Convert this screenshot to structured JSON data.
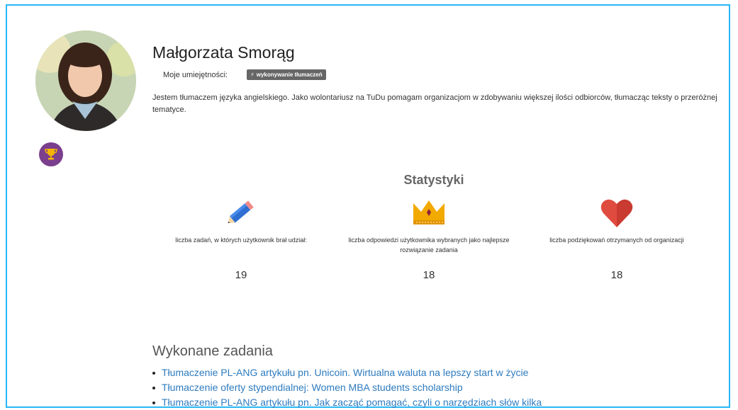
{
  "profile": {
    "name": "Małgorzata Smorąg",
    "skills_label": "Moje umiejętności:",
    "skills": [
      "wykonywanie tłumaczeń"
    ],
    "bio": "Jestem tłumaczem języka angielskiego. Jako wolontariusz na TuDu pomagam organizacjom w zdobywaniu większej ilości odbiorców, tłumacząc teksty o przeróżnej tematyce."
  },
  "stats": {
    "title": "Statystyki",
    "items": [
      {
        "icon": "pencil-icon",
        "label": "liczba zadań, w których użytkownik brał udział:",
        "value": "19"
      },
      {
        "icon": "crown-icon",
        "label": "liczba odpowiedzi użytkownika wybranych jako najlepsze rozwiązanie zadania",
        "value": "18"
      },
      {
        "icon": "heart-icon",
        "label": "liczba podziękowań otrzymanych od organizacji",
        "value": "18"
      }
    ]
  },
  "tasks": {
    "title": "Wykonane zadania",
    "items": [
      "Tłumaczenie PL-ANG artykułu pn. Unicoin. Wirtualna waluta na lepszy start w życie",
      "Tłumaczenie oferty stypendialnej: Women MBA students scholarship",
      "Tłumaczenie PL-ANG artykułu pn. Jak zacząć pomagać, czyli o narzędziach słów kilka"
    ]
  },
  "colors": {
    "frame": "#29b6f6",
    "badge": "#7b3f8e",
    "link": "#2d7bbf",
    "skill_tag": "#666666",
    "heart": "#e04b3f",
    "crown": "#f2a900",
    "pencil": "#2f6fd1"
  }
}
